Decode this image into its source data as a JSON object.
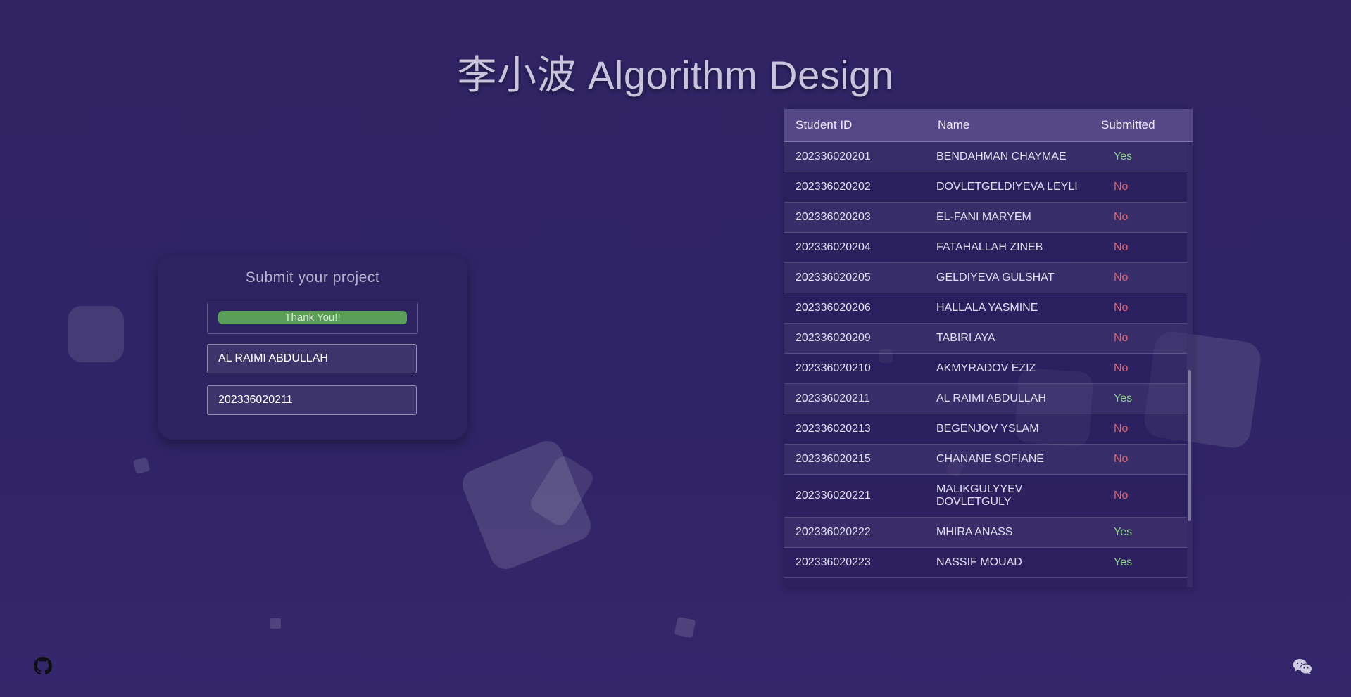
{
  "page": {
    "title": "李小波 Algorithm Design"
  },
  "submit_card": {
    "title": "Submit your project",
    "upload_status": "Thank You!!",
    "upload_progress": 1.0,
    "name_value": "AL RAIMI ABDULLAH",
    "id_value": "202336020211"
  },
  "table": {
    "headers": {
      "student_id": "Student ID",
      "name": "Name",
      "submitted": "Submitted"
    },
    "rows": [
      {
        "id": "202336020201",
        "name": "BENDAHMAN CHAYMAE",
        "submitted": "Yes"
      },
      {
        "id": "202336020202",
        "name": "DOVLETGELDIYEVA LEYLI",
        "submitted": "No"
      },
      {
        "id": "202336020203",
        "name": "EL-FANI MARYEM",
        "submitted": "No"
      },
      {
        "id": "202336020204",
        "name": "FATAHALLAH ZINEB",
        "submitted": "No"
      },
      {
        "id": "202336020205",
        "name": "GELDIYEVA GULSHAT",
        "submitted": "No"
      },
      {
        "id": "202336020206",
        "name": "HALLALA YASMINE",
        "submitted": "No"
      },
      {
        "id": "202336020209",
        "name": "TABIRI AYA",
        "submitted": "No"
      },
      {
        "id": "202336020210",
        "name": "AKMYRADOV EZIZ",
        "submitted": "No"
      },
      {
        "id": "202336020211",
        "name": "AL RAIMI ABDULLAH",
        "submitted": "Yes"
      },
      {
        "id": "202336020213",
        "name": "BEGENJOV YSLAM",
        "submitted": "No"
      },
      {
        "id": "202336020215",
        "name": "CHANANE SOFIANE",
        "submitted": "No"
      },
      {
        "id": "202336020221",
        "name": "MALIKGULYYEV DOVLETGULY",
        "submitted": "No"
      },
      {
        "id": "202336020222",
        "name": "MHIRA ANASS",
        "submitted": "Yes"
      },
      {
        "id": "202336020223",
        "name": "NASSIF MOUAD",
        "submitted": "Yes"
      }
    ]
  },
  "colors": {
    "yes": "#8fd48a",
    "no": "#e0646e",
    "progress": "#5a9e5a"
  },
  "footer": {
    "left_icon": "github-icon",
    "right_icon": "wechat-icon"
  }
}
